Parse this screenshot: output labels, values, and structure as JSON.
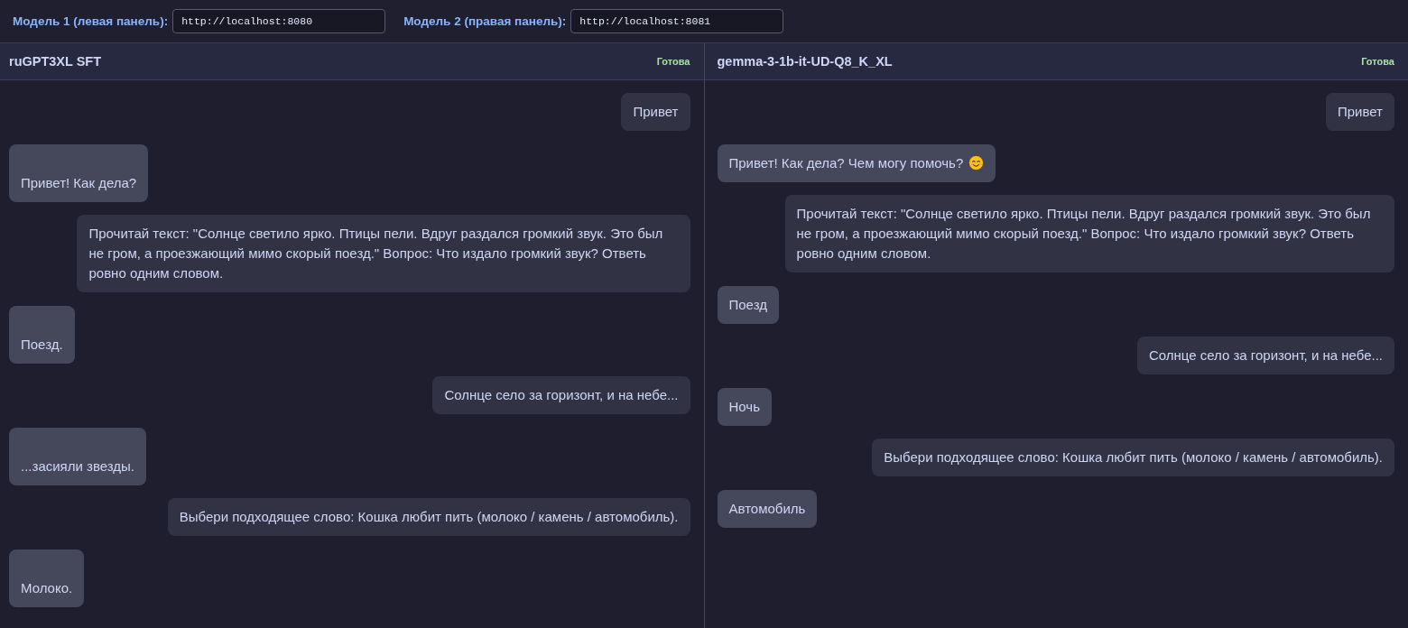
{
  "top_bar": {
    "fields": [
      {
        "label": "Модель 1 (левая панель):",
        "value": "http://localhost:8080"
      },
      {
        "label": "Модель 2 (правая панель):",
        "value": "http://localhost:8081"
      }
    ]
  },
  "panels": [
    {
      "title": "ruGPT3XL SFT",
      "status": "Готова",
      "messages": [
        {
          "kind": "user",
          "text": "Привет"
        },
        {
          "kind": "assistant",
          "text": "\nПривет! Как дела?"
        },
        {
          "kind": "user",
          "text": "Прочитай текст: \"Солнце светило ярко. Птицы пели. Вдруг раздался громкий звук. Это был не гром, а проезжающий мимо скорый поезд.\" Вопрос: Что издало громкий звук? Ответь ровно одним словом."
        },
        {
          "kind": "assistant",
          "text": "\nПоезд."
        },
        {
          "kind": "user",
          "text": "Солнце село за горизонт, и на небе..."
        },
        {
          "kind": "assistant",
          "text": "\n...засияли звезды."
        },
        {
          "kind": "user",
          "text": "Выбери подходящее слово: Кошка любит пить (молоко / камень / автомобиль)."
        },
        {
          "kind": "assistant",
          "text": "\nМолоко."
        }
      ]
    },
    {
      "title": "gemma-3-1b-it-UD-Q8_K_XL",
      "status": "Готова",
      "messages": [
        {
          "kind": "user",
          "text": "Привет"
        },
        {
          "kind": "assistant",
          "text": "Привет! Как дела? Чем могу помочь?",
          "has_emoji": true
        },
        {
          "kind": "user",
          "text": "Прочитай текст: \"Солнце светило ярко. Птицы пели. Вдруг раздался громкий звук. Это был не гром, а проезжающий мимо скорый поезд.\" Вопрос: Что издало громкий звук? Ответь ровно одним словом."
        },
        {
          "kind": "assistant",
          "text": "Поезд"
        },
        {
          "kind": "user",
          "text": "Солнце село за горизонт, и на небе..."
        },
        {
          "kind": "assistant",
          "text": "Ночь"
        },
        {
          "kind": "user",
          "text": "Выбери подходящее слово: Кошка любит пить (молоко / камень / автомобиль)."
        },
        {
          "kind": "assistant",
          "text": "Автомобиль"
        }
      ]
    }
  ]
}
